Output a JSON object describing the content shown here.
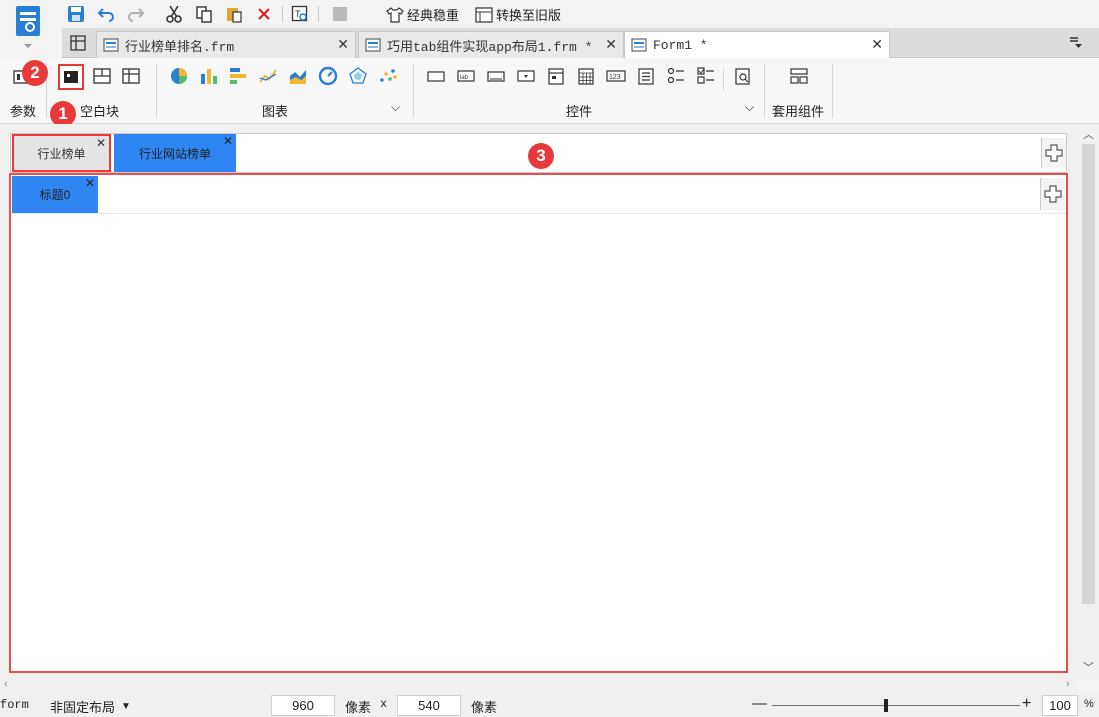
{
  "toolbar": {
    "classic_label": "经典稳重",
    "convert_label": "转换至旧版"
  },
  "file_tabs": [
    {
      "label": "行业榜单排名.frm"
    },
    {
      "label": "巧用tab组件实现app布局1.frm *"
    },
    {
      "label": "Form1 *"
    }
  ],
  "ribbon": {
    "param_label": "参数",
    "blank_label": "空白块",
    "chart_label": "图表",
    "control_label": "控件",
    "template_label": "套用组件"
  },
  "canvas": {
    "tabs": [
      {
        "label": "行业榜单"
      },
      {
        "label": "行业网站榜单"
      }
    ],
    "inner_tabs": [
      {
        "label": "标题0"
      }
    ]
  },
  "annotations": {
    "one": "1",
    "two": "2",
    "three": "3"
  },
  "status": {
    "form_label": "form",
    "layout_label": "非固定布局",
    "width_value": "960",
    "unit1": "像素",
    "x_label": "x",
    "height_value": "540",
    "unit2": "像素",
    "zoom_value": "100",
    "zoom_unit": "%"
  },
  "colors": {
    "accent_blue": "#2f86f2",
    "highlight_red": "#e83a3a",
    "icon_blue": "#2a7fd4"
  }
}
